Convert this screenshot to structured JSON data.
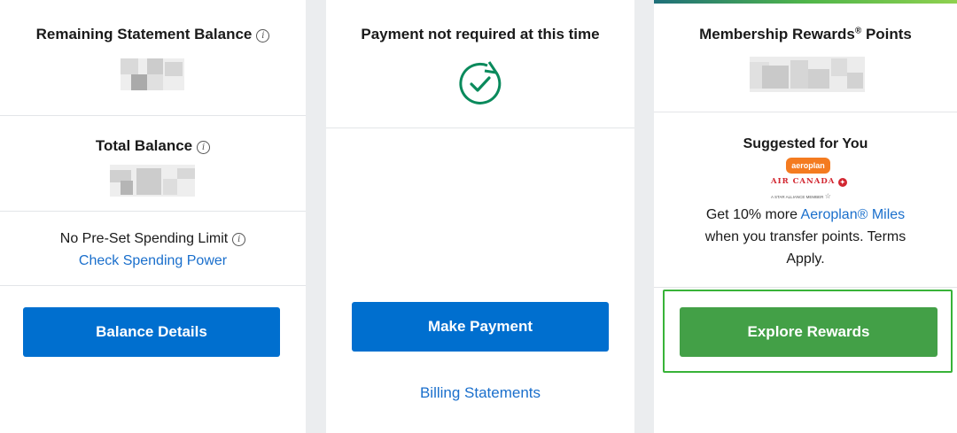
{
  "col1": {
    "remaining_title": "Remaining Statement Balance",
    "total_title": "Total Balance",
    "spending_title": "No Pre-Set Spending Limit",
    "spending_link": "Check Spending Power",
    "balance_button": "Balance Details"
  },
  "col2": {
    "payment_status": "Payment not required at this time",
    "make_payment_button": "Make Payment",
    "billing_link": "Billing Statements"
  },
  "col3": {
    "points_title": "Membership Rewards",
    "points_title_reg": "®",
    "points_title_suffix": " Points",
    "suggested_title": "Suggested for You",
    "logo_aeroplan": "aeroplan",
    "logo_aircanada": "AIR CANADA",
    "logo_star": "A STAR ALLIANCE MEMBER",
    "offer_prefix": "Get 10% more ",
    "offer_link": "Aeroplan® Miles",
    "offer_suffix_line1": "when you transfer points. Terms",
    "offer_suffix_line2": "Apply.",
    "explore_button": "Explore Rewards"
  },
  "colors": {
    "primary_blue": "#006fcf",
    "link_blue": "#1a6fcc",
    "green_button": "#43a047",
    "check_green": "#0a8a5c",
    "aeroplan_orange": "#f47b20",
    "aircanada_red": "#d22630"
  },
  "icons": {
    "info": "info-icon",
    "check_circle": "refresh-check-icon",
    "maple_leaf": "maple-leaf-icon"
  }
}
